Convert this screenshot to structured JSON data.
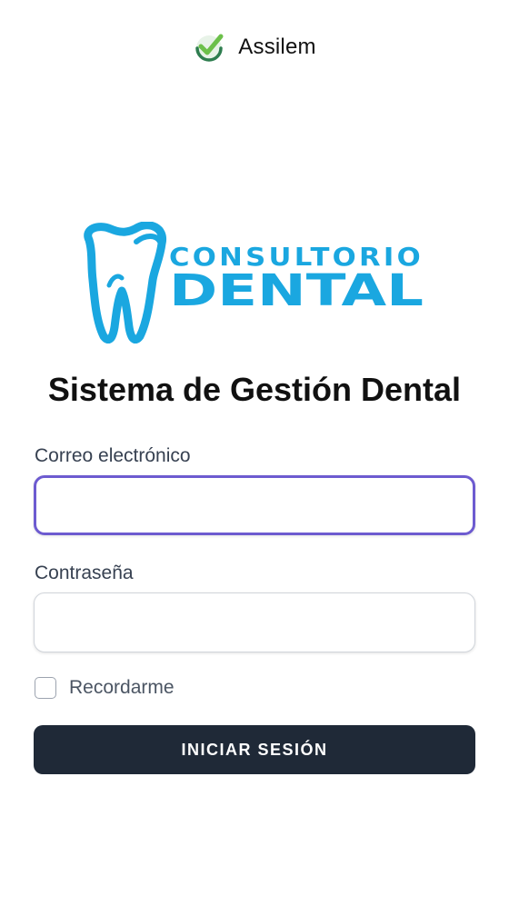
{
  "header": {
    "brand_name": "Assilem",
    "brand_icon": "check-badge-icon"
  },
  "logo": {
    "line1": "CONSULTORIO",
    "line2": "DENTAL",
    "icon": "tooth-icon",
    "color": "#1aa7e0"
  },
  "form": {
    "title": "Sistema de Gestión Dental",
    "email_label": "Correo electrónico",
    "email_value": "",
    "password_label": "Contraseña",
    "password_value": "",
    "remember_label": "Recordarme",
    "remember_checked": false,
    "submit_label": "INICIAR SESIÓN"
  },
  "colors": {
    "focus_border": "#6d5bd0",
    "button_bg": "#1f2937",
    "logo_blue": "#1aa7e0"
  }
}
